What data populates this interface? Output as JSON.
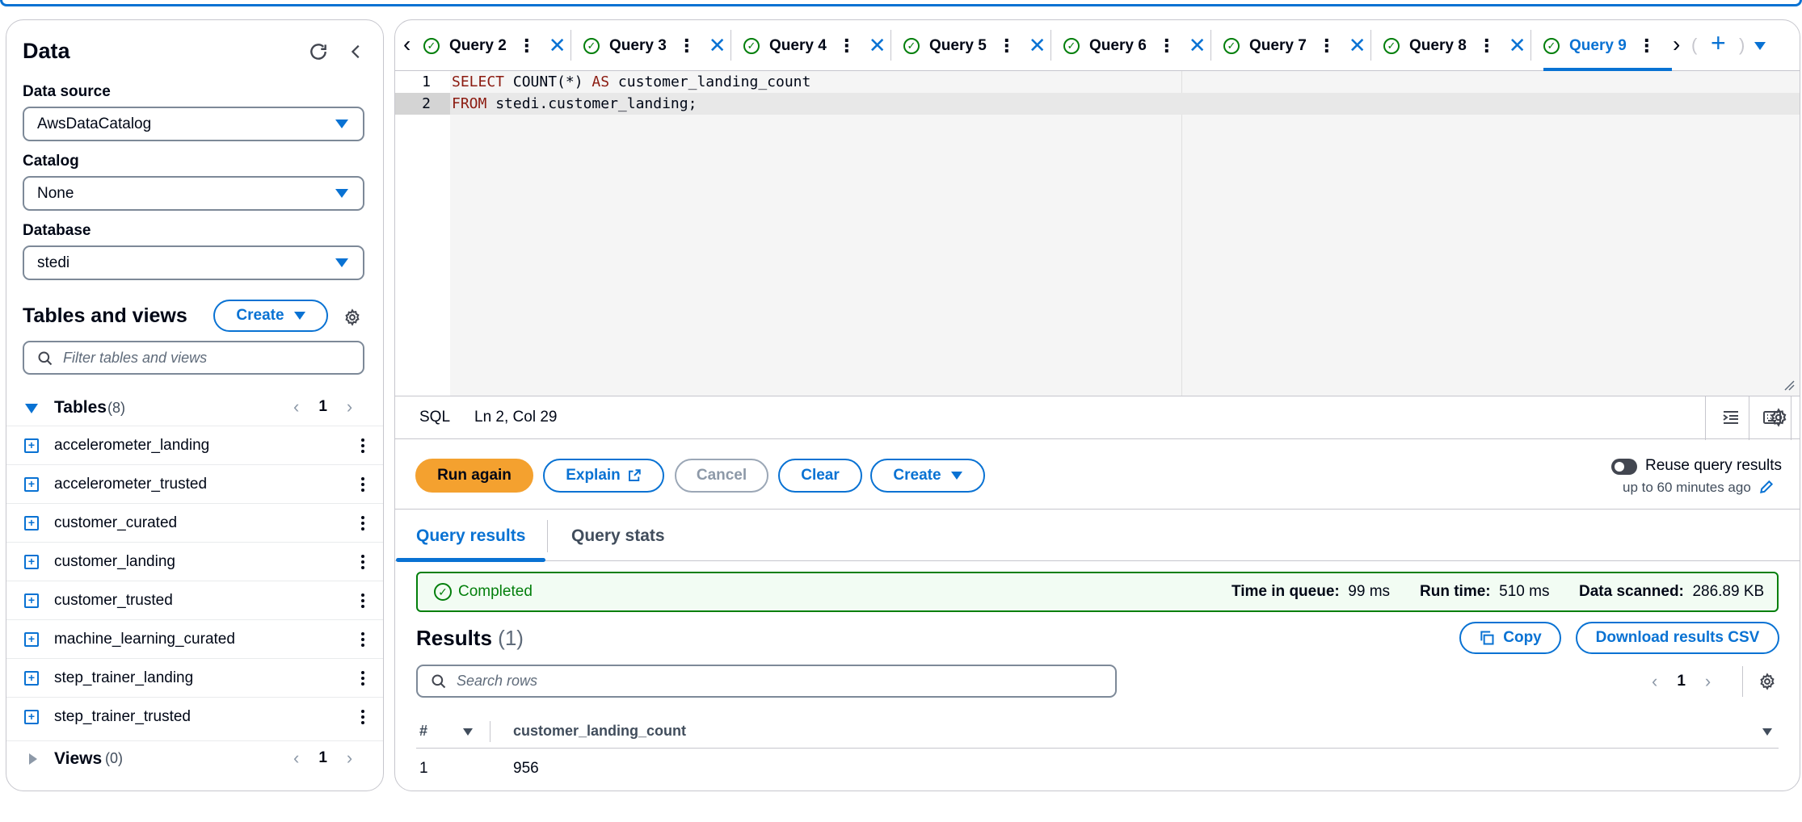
{
  "left_panel": {
    "title": "Data",
    "data_source_label": "Data source",
    "data_source_value": "AwsDataCatalog",
    "catalog_label": "Catalog",
    "catalog_value": "None",
    "database_label": "Database",
    "database_value": "stedi",
    "tables_views_title": "Tables and views",
    "create_label": "Create",
    "filter_placeholder": "Filter tables and views",
    "tables_label": "Tables",
    "tables_count": "(8)",
    "tables_page": "1",
    "tables": [
      {
        "name": "accelerometer_landing"
      },
      {
        "name": "accelerometer_trusted"
      },
      {
        "name": "customer_curated"
      },
      {
        "name": "customer_landing"
      },
      {
        "name": "customer_trusted"
      },
      {
        "name": "machine_learning_curated"
      },
      {
        "name": "step_trainer_landing"
      },
      {
        "name": "step_trainer_trusted"
      }
    ],
    "views_label": "Views",
    "views_count": "(0)",
    "views_page": "1"
  },
  "tabs": [
    {
      "label": "Query 2"
    },
    {
      "label": "Query 3"
    },
    {
      "label": "Query 4"
    },
    {
      "label": "Query 5"
    },
    {
      "label": "Query 6"
    },
    {
      "label": "Query 7"
    },
    {
      "label": "Query 8"
    },
    {
      "label": "Query 9"
    }
  ],
  "editor": {
    "line1_no": "1",
    "line1_kw1": "SELECT",
    "line1_mid": " COUNT(*) ",
    "line1_kw2": "AS",
    "line1_rest": " customer_landing_count",
    "line2_no": "2",
    "line2_kw": "FROM",
    "line2_rest": " stedi.customer_landing;"
  },
  "status": {
    "language": "SQL",
    "position": "Ln 2, Col 29"
  },
  "actions": {
    "run_again": "Run again",
    "explain": "Explain",
    "cancel": "Cancel",
    "clear": "Clear",
    "create": "Create",
    "reuse_label": "Reuse query results",
    "reuse_sub": "up to 60 minutes ago"
  },
  "result_tabs": {
    "results": "Query results",
    "stats": "Query stats"
  },
  "completion": {
    "status": "Completed",
    "queue_label": "Time in queue:",
    "queue_value": "99 ms",
    "run_label": "Run time:",
    "run_value": "510 ms",
    "scanned_label": "Data scanned:",
    "scanned_value": "286.89 KB"
  },
  "results": {
    "title": "Results",
    "count": "(1)",
    "copy": "Copy",
    "download": "Download results CSV",
    "search_placeholder": "Search rows",
    "page": "1",
    "col_index": "#",
    "col_name": "customer_landing_count",
    "rows": [
      {
        "index": "1",
        "value": "956"
      }
    ]
  },
  "colors": {
    "accent": "#0972d3",
    "primary_button": "#f4a12f",
    "success": "#037f0c"
  }
}
